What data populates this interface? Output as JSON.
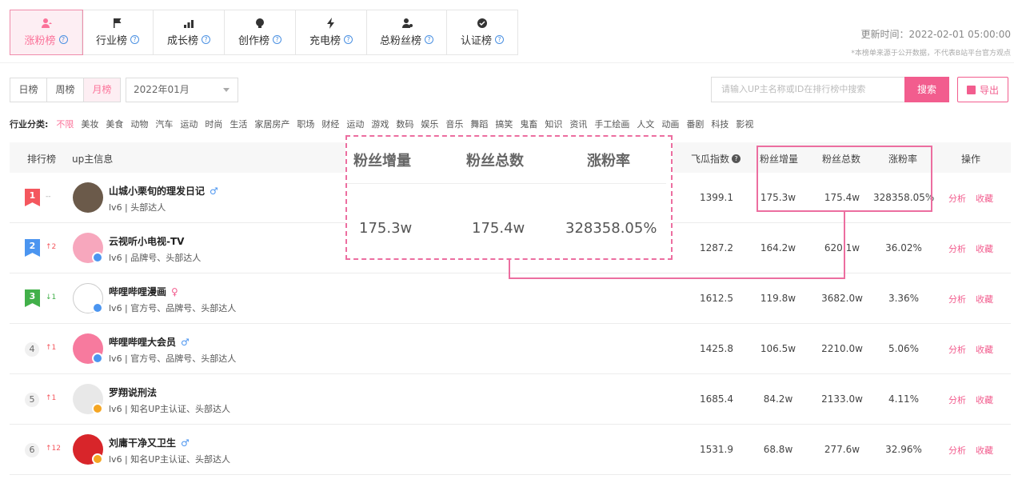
{
  "tabs": [
    {
      "label": "涨粉榜",
      "icon": "user-up-icon",
      "active": true
    },
    {
      "label": "行业榜",
      "icon": "flag-icon",
      "active": false
    },
    {
      "label": "成长榜",
      "icon": "growth-bars-icon",
      "active": false
    },
    {
      "label": "创作榜",
      "icon": "bulb-icon",
      "active": false
    },
    {
      "label": "充电榜",
      "icon": "lightning-icon",
      "active": false
    },
    {
      "label": "总粉丝榜",
      "icon": "user-heart-icon",
      "active": false
    },
    {
      "label": "认证榜",
      "icon": "verified-badge-icon",
      "active": false
    }
  ],
  "meta": {
    "updated": "更新时间：2022-02-01 05:00:00",
    "note": "*本榜单来源于公开数据，不代表B站平台官方观点"
  },
  "period": [
    "日榜",
    "周榜",
    "月榜"
  ],
  "date_select": "2022年01月",
  "search": {
    "placeholder": "请输入UP主名称或ID在排行榜中搜索",
    "button": "搜索"
  },
  "export_label": "导出",
  "categories": {
    "label": "行业分类:",
    "items": [
      "不限",
      "美妆",
      "美食",
      "动物",
      "汽车",
      "运动",
      "时尚",
      "生活",
      "家居房产",
      "职场",
      "财经",
      "运动",
      "游戏",
      "数码",
      "娱乐",
      "音乐",
      "舞蹈",
      "搞笑",
      "鬼畜",
      "知识",
      "资讯",
      "手工绘画",
      "人文",
      "动画",
      "番剧",
      "科技",
      "影视"
    ]
  },
  "table_headers": {
    "rank": "排行榜",
    "info": "up主信息",
    "index": "飞瓜指数",
    "gain": "粉丝增量",
    "total": "粉丝总数",
    "rate": "涨粉率",
    "ops": "操作"
  },
  "rows": [
    {
      "rank": "1",
      "trend": "--",
      "name": "山城小栗旬的理发日记",
      "gender": "♂",
      "desc": "lv6 | 头部达人",
      "index": "1399.1",
      "gain": "175.3w",
      "total": "175.4w",
      "rate": "328358.05%"
    },
    {
      "rank": "2",
      "trend": "↑2",
      "name": "云视听小电视-TV",
      "gender": "",
      "desc": "lv6 | 品牌号、头部达人",
      "index": "1287.2",
      "gain": "164.2w",
      "total": "620.1w",
      "rate": "36.02%"
    },
    {
      "rank": "3",
      "trend": "↓1",
      "name": "哔哩哔哩漫画",
      "gender": "♀",
      "desc": "lv6 | 官方号、品牌号、头部达人",
      "index": "1612.5",
      "gain": "119.8w",
      "total": "3682.0w",
      "rate": "3.36%"
    },
    {
      "rank": "4",
      "trend": "↑1",
      "name": "哔哩哔哩大会员",
      "gender": "♂",
      "desc": "lv6 | 官方号、品牌号、头部达人",
      "index": "1425.8",
      "gain": "106.5w",
      "total": "2210.0w",
      "rate": "5.06%"
    },
    {
      "rank": "5",
      "trend": "↑1",
      "name": "罗翔说刑法",
      "gender": "",
      "desc": "lv6 | 知名UP主认证、头部达人",
      "index": "1685.4",
      "gain": "84.2w",
      "total": "2133.0w",
      "rate": "4.11%"
    },
    {
      "rank": "6",
      "trend": "↑12",
      "name": "刘庸干净又卫生",
      "gender": "♂",
      "desc": "lv6 | 知名UP主认证、头部达人",
      "index": "1531.9",
      "gain": "68.8w",
      "total": "277.6w",
      "rate": "32.96%"
    }
  ],
  "actions": {
    "analyze": "分析",
    "favorite": "收藏"
  },
  "zoom_callout": {
    "headers": [
      "粉丝增量",
      "粉丝总数",
      "涨粉率"
    ],
    "values": [
      "175.3w",
      "175.4w",
      "328358.05%"
    ]
  },
  "colors": {
    "accent": "#fb7299",
    "button": "#f25d8e",
    "rank1": "#f4575e",
    "rank2": "#4b95f0",
    "rank3": "#42b04a",
    "up": "#f4575e",
    "down": "#42b04a",
    "highlight": "#ec6ea0"
  }
}
